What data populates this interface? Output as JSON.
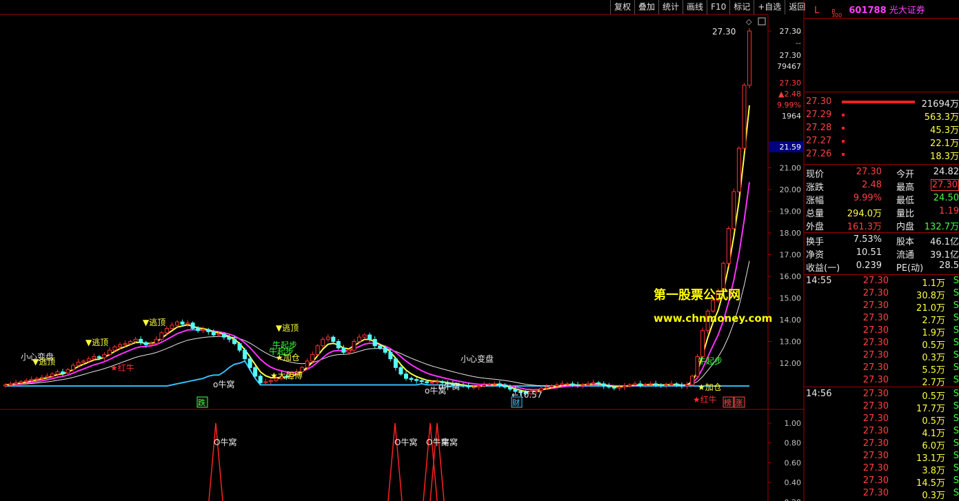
{
  "toolbar": {
    "items": [
      "复权",
      "叠加",
      "统计",
      "画线",
      "F10",
      "标记",
      "+自选",
      "返回"
    ]
  },
  "stock": {
    "prefix": "L",
    "r_badge": "R",
    "r_sub": "300",
    "code": "601788",
    "name": "光大证券"
  },
  "price_axis": {
    "ticks": [
      "27.30",
      "21.00",
      "20.00",
      "19.00",
      "18.00",
      "17.00",
      "16.00",
      "15.00",
      "14.00",
      "13.00",
      "12.00"
    ],
    "extra_labels": [
      "--",
      "--",
      "27.30",
      "79467",
      "27.30",
      "▲2.48",
      "9.99%",
      "1964"
    ],
    "highlight_label": "21.59"
  },
  "sub_axis": {
    "ticks": [
      "1.00",
      "0.80",
      "0.60",
      "0.40",
      "0.20"
    ]
  },
  "chart_data": {
    "type": "candlestick",
    "ylim": [
      10.3,
      28.0
    ],
    "close": [
      11.0,
      11.05,
      11.1,
      11.15,
      11.2,
      11.25,
      11.3,
      11.35,
      11.4,
      11.5,
      11.6,
      11.55,
      11.7,
      11.9,
      12.05,
      12.1,
      12.2,
      12.3,
      12.25,
      12.4,
      12.6,
      12.75,
      12.85,
      12.9,
      13.0,
      13.1,
      12.95,
      12.85,
      12.9,
      13.1,
      13.4,
      13.6,
      13.75,
      13.9,
      13.8,
      13.85,
      13.6,
      13.5,
      13.55,
      13.45,
      13.3,
      13.35,
      13.2,
      13.1,
      12.9,
      12.6,
      12.2,
      11.8,
      11.4,
      11.1,
      11.15,
      11.2,
      11.3,
      11.4,
      11.35,
      11.5,
      11.6,
      11.8,
      12.1,
      12.4,
      12.8,
      13.1,
      13.2,
      13.0,
      12.7,
      12.5,
      12.6,
      13.0,
      13.2,
      13.3,
      13.1,
      12.8,
      12.7,
      12.5,
      12.2,
      11.8,
      11.5,
      11.3,
      11.25,
      11.2,
      11.15,
      11.1,
      11.12,
      11.15,
      11.1,
      11.05,
      11.0,
      10.98,
      10.95,
      10.9,
      10.9,
      10.95,
      11.0,
      11.02,
      11.05,
      11.0,
      10.9,
      10.8,
      10.7,
      10.65,
      10.6,
      10.7,
      10.75,
      10.85,
      10.9,
      10.95,
      11.0,
      11.05,
      11.05,
      11.0,
      10.98,
      11.0,
      11.05,
      11.1,
      11.05,
      10.95,
      10.9,
      10.85,
      10.9,
      10.95,
      11.0,
      11.05,
      11.0,
      11.02,
      11.05,
      11.0,
      10.98,
      11.0,
      11.05,
      11.0,
      10.95,
      11.0,
      11.4,
      12.3,
      13.5,
      14.4,
      14.9,
      15.3,
      16.6,
      18.2,
      19.9,
      21.9,
      24.8,
      27.3
    ],
    "indicators": [
      "白线",
      "黄线",
      "紫线",
      "蓝线"
    ],
    "annotations": [
      {
        "text": "小心变盘",
        "style": "white"
      },
      {
        "text": "▼逃顶",
        "style": "yellow"
      },
      {
        "text": "▼逃顶",
        "style": "yellow"
      },
      {
        "text": "▼逃顶",
        "style": "yellow"
      },
      {
        "text": "▼逃顶",
        "style": "yellow"
      },
      {
        "text": "★红牛",
        "style": "red"
      },
      {
        "text": "o牛窝",
        "style": "white"
      },
      {
        "text": "★大胆博",
        "style": "yellow"
      },
      {
        "text": "★加仓",
        "style": "yellow"
      },
      {
        "text": "牛起步",
        "style": "green"
      },
      {
        "text": "小心变盘",
        "style": "white"
      },
      {
        "text": "o牛窝",
        "style": "white"
      },
      {
        "text": "o牛窝",
        "style": "white"
      },
      {
        "text": "←10.57",
        "style": "white"
      },
      {
        "text": "牛起步",
        "style": "green"
      },
      {
        "text": "★加仓",
        "style": "yellow"
      },
      {
        "text": "★红牛",
        "style": "red"
      },
      {
        "text": "牛起步",
        "style": "green"
      },
      {
        "text": "27.30",
        "style": "white"
      }
    ],
    "markers": [
      "跌",
      "财",
      "榜",
      "涨"
    ],
    "sub": {
      "type": "spikes",
      "ylim": [
        0.0,
        1.0
      ],
      "labels": [
        "O牛窝",
        "O牛窝",
        "O牛窝",
        "牛窝"
      ]
    }
  },
  "watermark": {
    "line1": "第一股票公式网",
    "line2": "www.chnmoney.com"
  },
  "quote_board": {
    "levels": [
      {
        "price": "27.30",
        "vol": "21694万"
      },
      {
        "price": "27.29",
        "vol": "563.3万"
      },
      {
        "price": "27.28",
        "vol": "45.3万"
      },
      {
        "price": "27.27",
        "vol": "22.1万"
      },
      {
        "price": "27.26",
        "vol": "18.3万"
      }
    ],
    "stats": [
      {
        "l1": "现价",
        "v1": "27.30",
        "l2": "今开",
        "v2": "24.82"
      },
      {
        "l1": "涨跌",
        "v1": "2.48",
        "l2": "最高",
        "v2": "27.30"
      },
      {
        "l1": "涨幅",
        "v1": "9.99%",
        "l2": "最低",
        "v2": "24.50"
      },
      {
        "l1": "总量",
        "v1": "294.0万",
        "l2": "量比",
        "v2": "1.19"
      },
      {
        "l1": "外盘",
        "v1": "161.3万",
        "l2": "内盘",
        "v2": "132.7万"
      },
      {
        "l1": "换手",
        "v1": "7.53%",
        "l2": "股本",
        "v2": "46.1亿"
      },
      {
        "l1": "净资",
        "v1": "10.51",
        "l2": "流通",
        "v2": "39.1亿"
      },
      {
        "l1": "收益(一)",
        "v1": "0.239",
        "l2": "PE(动)",
        "v2": "28.5"
      }
    ],
    "ticks": [
      {
        "time": "14:55",
        "price": "27.30",
        "vol": "1.1万",
        "s": "S"
      },
      {
        "time": "",
        "price": "27.30",
        "vol": "30.8万",
        "s": "S"
      },
      {
        "time": "",
        "price": "27.30",
        "vol": "21.0万",
        "s": "S"
      },
      {
        "time": "",
        "price": "27.30",
        "vol": "2.7万",
        "s": "S"
      },
      {
        "time": "",
        "price": "27.30",
        "vol": "1.9万",
        "s": "S"
      },
      {
        "time": "",
        "price": "27.30",
        "vol": "0.5万",
        "s": "S"
      },
      {
        "time": "",
        "price": "27.30",
        "vol": "0.3万",
        "s": "S"
      },
      {
        "time": "",
        "price": "27.30",
        "vol": "5.5万",
        "s": "S"
      },
      {
        "time": "",
        "price": "27.30",
        "vol": "2.7万",
        "s": "S"
      },
      {
        "time": "14:56",
        "price": "27.30",
        "vol": "0.5万",
        "s": "S"
      },
      {
        "time": "",
        "price": "27.30",
        "vol": "17.7万",
        "s": "S"
      },
      {
        "time": "",
        "price": "27.30",
        "vol": "0.5万",
        "s": "S"
      },
      {
        "time": "",
        "price": "27.30",
        "vol": "4.1万",
        "s": "S"
      },
      {
        "time": "",
        "price": "27.30",
        "vol": "6.0万",
        "s": "S"
      },
      {
        "time": "",
        "price": "27.30",
        "vol": "13.1万",
        "s": "S"
      },
      {
        "time": "",
        "price": "27.30",
        "vol": "3.8万",
        "s": "S"
      },
      {
        "time": "",
        "price": "27.30",
        "vol": "14.5万",
        "s": "S"
      },
      {
        "time": "",
        "price": "27.30",
        "vol": "0.3万",
        "s": "S"
      }
    ]
  }
}
